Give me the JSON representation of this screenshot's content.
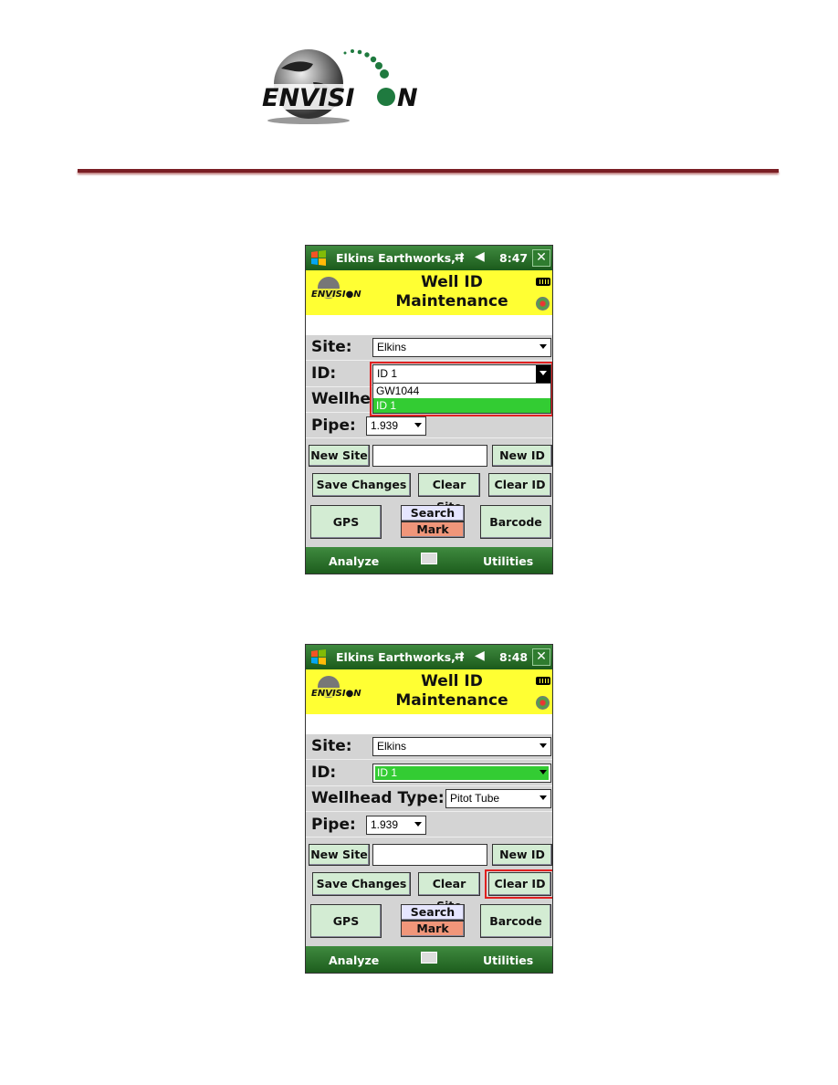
{
  "logo_text": "ENVISION",
  "colors": {
    "rule": "#7a1e24",
    "titlebar": "#2a6e2a",
    "header": "#ffff33",
    "button": "#d3ecd3",
    "highlight": "#33cc33",
    "mark": "#f0967a",
    "search": "#e6e6ff",
    "callout": "#e02020"
  },
  "screens": [
    {
      "title": "Elkins Earthworks, I",
      "time": "8:47",
      "close": "✕",
      "header_line1": "Well ID",
      "header_line2": "Maintenance",
      "site_label": "Site:",
      "site_value": "Elkins",
      "id_label": "ID:",
      "id_value": "ID 1",
      "wellhead_label": "Wellhe",
      "dropdown_options": [
        "GW1044",
        "ID 1"
      ],
      "pipe_label": "Pipe:",
      "pipe_value": "1.939",
      "new_site": "New Site",
      "new_id": "New ID",
      "save_changes": "Save Changes",
      "clear_site": "Clear Site",
      "clear_id": "Clear ID",
      "gps": "GPS",
      "search": "Search",
      "mark": "Mark",
      "barcode": "Barcode",
      "analyze": "Analyze",
      "utilities": "Utilities"
    },
    {
      "title": "Elkins Earthworks, I",
      "time": "8:48",
      "close": "✕",
      "header_line1": "Well ID",
      "header_line2": "Maintenance",
      "site_label": "Site:",
      "site_value": "Elkins",
      "id_label": "ID:",
      "id_value": "ID 1",
      "wellhead_label": "Wellhead Type:",
      "wellhead_value": "Pitot Tube",
      "pipe_label": "Pipe:",
      "pipe_value": "1.939",
      "new_site": "New Site",
      "new_id": "New ID",
      "save_changes": "Save Changes",
      "clear_site": "Clear Site",
      "clear_id": "Clear ID",
      "gps": "GPS",
      "search": "Search",
      "mark": "Mark",
      "barcode": "Barcode",
      "analyze": "Analyze",
      "utilities": "Utilities"
    }
  ]
}
